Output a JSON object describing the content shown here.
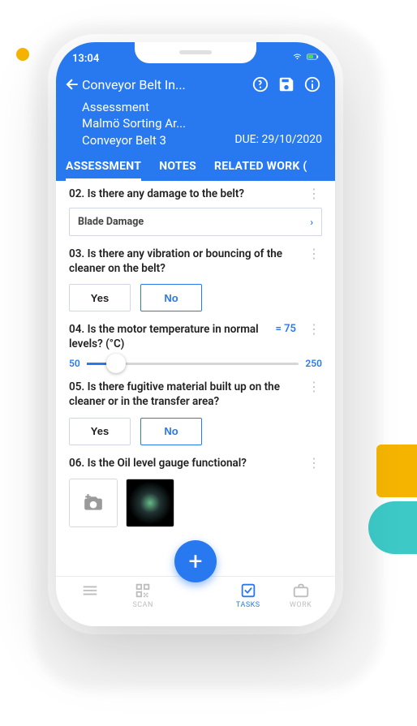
{
  "status": {
    "time": "13:04"
  },
  "header": {
    "title": "Conveyor Belt In...",
    "subtitle1": "Assessment",
    "subtitle2": "Malmö Sorting Ar...",
    "subtitle3": "Conveyor Belt 3",
    "due_label": "DUE: 29/10/2020"
  },
  "tabs": {
    "assessment": "ASSESSMENT",
    "notes": "NOTES",
    "related": "RELATED WORK ("
  },
  "questions": {
    "q2": {
      "label": "02. Is there any damage to the belt?",
      "value": "Blade Damage"
    },
    "q3": {
      "label": "03. Is there any vibration or bouncing of the cleaner on the belt?",
      "yes": "Yes",
      "no": "No"
    },
    "q4": {
      "label": "04. Is the motor temperature in normal levels? (°C)",
      "value_display": "= 75",
      "min": "50",
      "max": "250"
    },
    "q5": {
      "label": "05. Is there fugitive material built up on the cleaner or in the transfer area?",
      "yes": "Yes",
      "no": "No"
    },
    "q6": {
      "label": "06. Is the Oil level gauge functional?"
    }
  },
  "bottomnav": {
    "scan": "SCAN",
    "tasks": "TASKS",
    "work": "WORK"
  },
  "fab": {
    "label": "+"
  }
}
